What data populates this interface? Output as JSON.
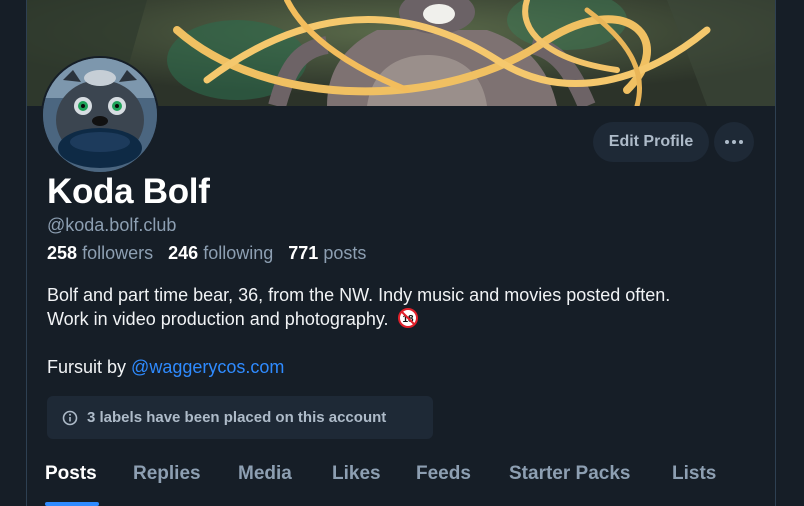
{
  "profile": {
    "display_name": "Koda Bolf",
    "handle": "@koda.bolf.club",
    "stats": {
      "followers_count": "258",
      "followers_label": "followers",
      "following_count": "246",
      "following_label": "following",
      "posts_count": "771",
      "posts_label": "posts"
    },
    "bio_line1": "Bolf and part time bear, 36, from the NW. Indy music and movies posted often.",
    "bio_line2": "Work in video production and photography.",
    "adult_badge": "18",
    "fursuit_prefix": "Fursuit by",
    "fursuit_mention": "@waggerycos.com",
    "labels_notice": "3 labels have been placed on this account"
  },
  "actions": {
    "edit_profile_label": "Edit Profile",
    "more_icon": "ellipsis-icon"
  },
  "tabs": [
    {
      "label": "Posts",
      "active": true
    },
    {
      "label": "Replies"
    },
    {
      "label": "Media"
    },
    {
      "label": "Likes"
    },
    {
      "label": "Feeds"
    },
    {
      "label": "Starter Packs"
    },
    {
      "label": "Lists"
    }
  ],
  "colors": {
    "background": "#161e27",
    "accent": "#2f8bff",
    "button_bg": "#1e2936",
    "muted_text": "#8d9fb2"
  }
}
